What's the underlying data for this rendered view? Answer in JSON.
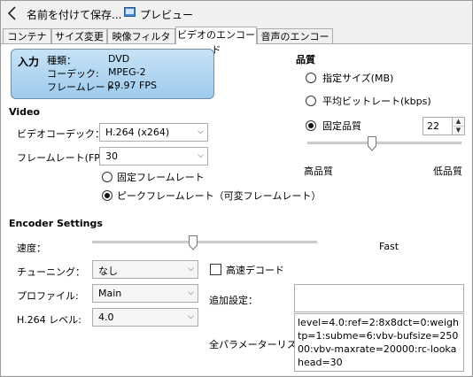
{
  "toolbar": {
    "save_as_label": "名前を付けて保存...",
    "preview_label": "プレビュー"
  },
  "tabs": [
    {
      "label": "コンテナー"
    },
    {
      "label": "サイズ変更"
    },
    {
      "label": "映像フィルター"
    },
    {
      "label": "ビデオのエンコード",
      "active": true
    },
    {
      "label": "音声のエンコード"
    }
  ],
  "source_info": {
    "title": "入力",
    "type_label": "種類：",
    "type_value": "DVD",
    "codec_label": "コーデック:",
    "codec_value": "MPEG-2",
    "framerate_label": "フレームレート:",
    "framerate_value": "29.97 FPS"
  },
  "video": {
    "section_title": "Video",
    "codec_label": "ビデオコーデック：",
    "codec_value": "H.264 (x264)",
    "framerate_label": "フレームレート(FPS):",
    "framerate_value": "30",
    "constant_fr_label": "固定フレームレート",
    "peak_fr_label": "ピークフレームレート（可変フレームレート）",
    "selected_framerate_mode": "peak"
  },
  "quality": {
    "section_title": "品質",
    "target_size_label": "指定サイズ(MB)",
    "avg_bitrate_label": "平均ビットレート(kbps)",
    "constant_quality_label": "固定品質",
    "selected_mode": "constant_quality",
    "value": "22",
    "slider_level": 0.42,
    "high_label": "高品質",
    "low_label": "低品質"
  },
  "encoder": {
    "section_title": "Encoder Settings",
    "speed_label": "速度：",
    "speed_level": 0.45,
    "speed_value_label": "Fast",
    "tune_label": "チューニング：",
    "tune_value": "なし",
    "fast_decode_label": "高速デコード",
    "fast_decode_checked": false,
    "profile_label": "プロファイル:",
    "profile_value": "Main",
    "extra_label": "追加設定：",
    "extra_value": "",
    "level_label": "H.264 レベル:",
    "level_value": "4.0",
    "params_label": "全パラメーターリスト:",
    "params_value": "level=4.0:ref=2:8x8dct=0:weightp=1:subme=6:vbv-bufsize=25000:vbv-maxrate=20000:rc-lookahead=30"
  }
}
